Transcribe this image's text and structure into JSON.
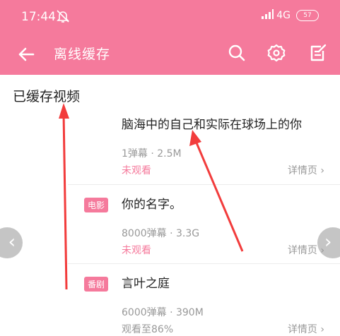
{
  "status_bar": {
    "time": "17:44",
    "network": "4G",
    "battery": "57"
  },
  "app_bar": {
    "title": "离线缓存",
    "icons": [
      "back-arrow-icon",
      "search-icon",
      "settings-icon",
      "edit-icon"
    ]
  },
  "section": {
    "title": "已缓存视频"
  },
  "items": [
    {
      "tag": "",
      "title": "脑海中的自己和实际在球场上的你",
      "meta": "1弹幕 · 2.5M",
      "status": "未观看",
      "details": "详情页 ›"
    },
    {
      "tag": "电影",
      "title": "你的名字。",
      "meta": "8000弹幕 · 3.3G",
      "status": "未观看",
      "details": "详情页 ›"
    },
    {
      "tag": "番剧",
      "title": "言叶之庭",
      "meta": "6000弹幕 · 390M",
      "status": "观看至86%",
      "details": "详情页 ›"
    }
  ],
  "colors": {
    "accent": "#f57a9c",
    "annotation_arrow": "#f23c3c"
  }
}
